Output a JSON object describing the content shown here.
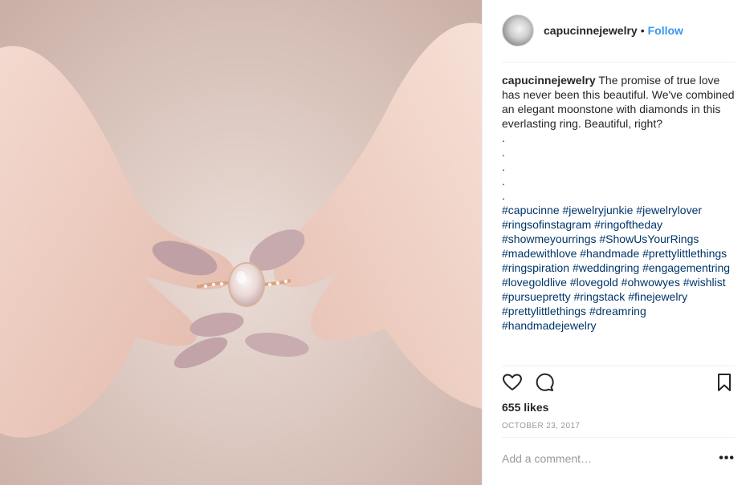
{
  "post": {
    "username": "capucinnejewelry",
    "separator": "•",
    "follow_label": "Follow",
    "caption_text": "The promise of true love has never been this beautiful. We've combined an elegant moonstone with diamonds in this everlasting ring. Beautiful, right?\n.\n.\n.\n.\n.",
    "hashtags": "#capucinne #jewelryjunkie #jewelrylover #ringsofinstagram #ringoftheday #showmeyourrings #ShowUsYourRings #madewithlove #handmade #prettylittlethings #ringspiration #weddingring #engagementring #lovegoldlive #lovegold #ohwowyes #wishlist #pursuepretty #ringstack #finejewelry #prettylittlethings #dreamring #handmadejewelry",
    "likes": "655 likes",
    "date": "OCTOBER 23, 2017",
    "comment_placeholder": "Add a comment…",
    "more_label": "•••"
  },
  "icons": {
    "like": "heart-icon",
    "comment": "comment-bubble-icon",
    "save": "bookmark-icon",
    "more": "more-options-icon"
  },
  "colors": {
    "link_blue": "#3897f0",
    "hashtag": "#003569",
    "muted": "#999999",
    "text": "#262626"
  }
}
